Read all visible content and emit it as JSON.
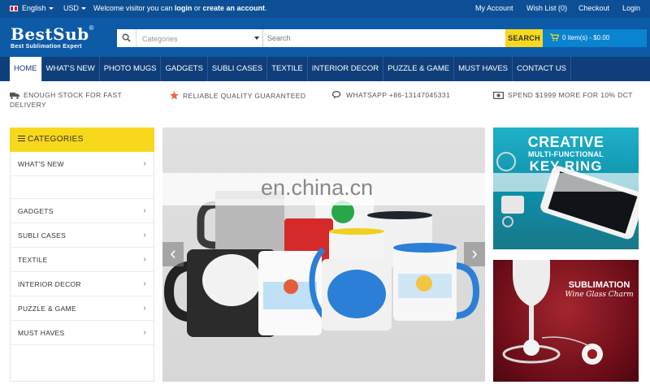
{
  "topbar": {
    "language": "English",
    "currency": "USD",
    "welcome_prefix": "Welcome visitor you can",
    "login_link": "login",
    "or_text": "or",
    "create_link": "create an account",
    "welcome_suffix": ".",
    "my_account": "My Account",
    "wish_list": "Wish List (0)",
    "checkout": "Checkout",
    "login": "Login"
  },
  "header": {
    "brand": "BestSub",
    "reg": "®",
    "tagline": "Best Sublimation Expert",
    "category_select": "Categories",
    "search_placeholder": "Search",
    "search_button": "SEARCH",
    "cart": "0 item(s) - $0.00"
  },
  "nav": {
    "tabs": [
      {
        "label": "HOME"
      },
      {
        "label": "WHAT'S NEW"
      },
      {
        "label": "PHOTO MUGS"
      },
      {
        "label": "GADGETS"
      },
      {
        "label": "SUBLI CASES"
      },
      {
        "label": "TEXTILE"
      },
      {
        "label": "INTERIOR DECOR"
      },
      {
        "label": "PUZZLE & GAME"
      },
      {
        "label": "MUST HAVES"
      },
      {
        "label": "CONTACT US"
      }
    ]
  },
  "features": [
    {
      "text": "ENOUGH STOCK FOR FAST",
      "text2": "DELIVERY",
      "icon": "truck-icon"
    },
    {
      "text": "RELIABLE QUALITY GUARANTEED",
      "icon": "star-icon"
    },
    {
      "text": "WHATSAPP +86-13147045331",
      "icon": "chat-icon"
    },
    {
      "text": "SPEND $1999 MORE FOR 10% DCT",
      "icon": "money-icon"
    }
  ],
  "categories": {
    "title": "CATEGORIES",
    "items": [
      {
        "label": "WHAT'S NEW"
      },
      {
        "label": ""
      },
      {
        "label": "GADGETS"
      },
      {
        "label": "SUBLI CASES"
      },
      {
        "label": "TEXTILE"
      },
      {
        "label": "INTERIOR DECOR"
      },
      {
        "label": "PUZZLE & GAME"
      },
      {
        "label": "MUST HAVES"
      }
    ]
  },
  "slider": {
    "watermark": "en.china.cn",
    "prev": "‹",
    "next": "›"
  },
  "banners": {
    "b1_line1": "CREATIVE",
    "b1_line2": "MULTI-FUNCTIONAL",
    "b1_line3": "KEY RING",
    "b2_line1": "SUBLIMATION",
    "b2_line2": "Wine Glass Charm"
  },
  "colors": {
    "topbar": "#0d4f95",
    "header": "#0d5aa7",
    "nav": "#0f3f7a",
    "accent": "#f8d81d",
    "cart": "#0a83d1"
  }
}
